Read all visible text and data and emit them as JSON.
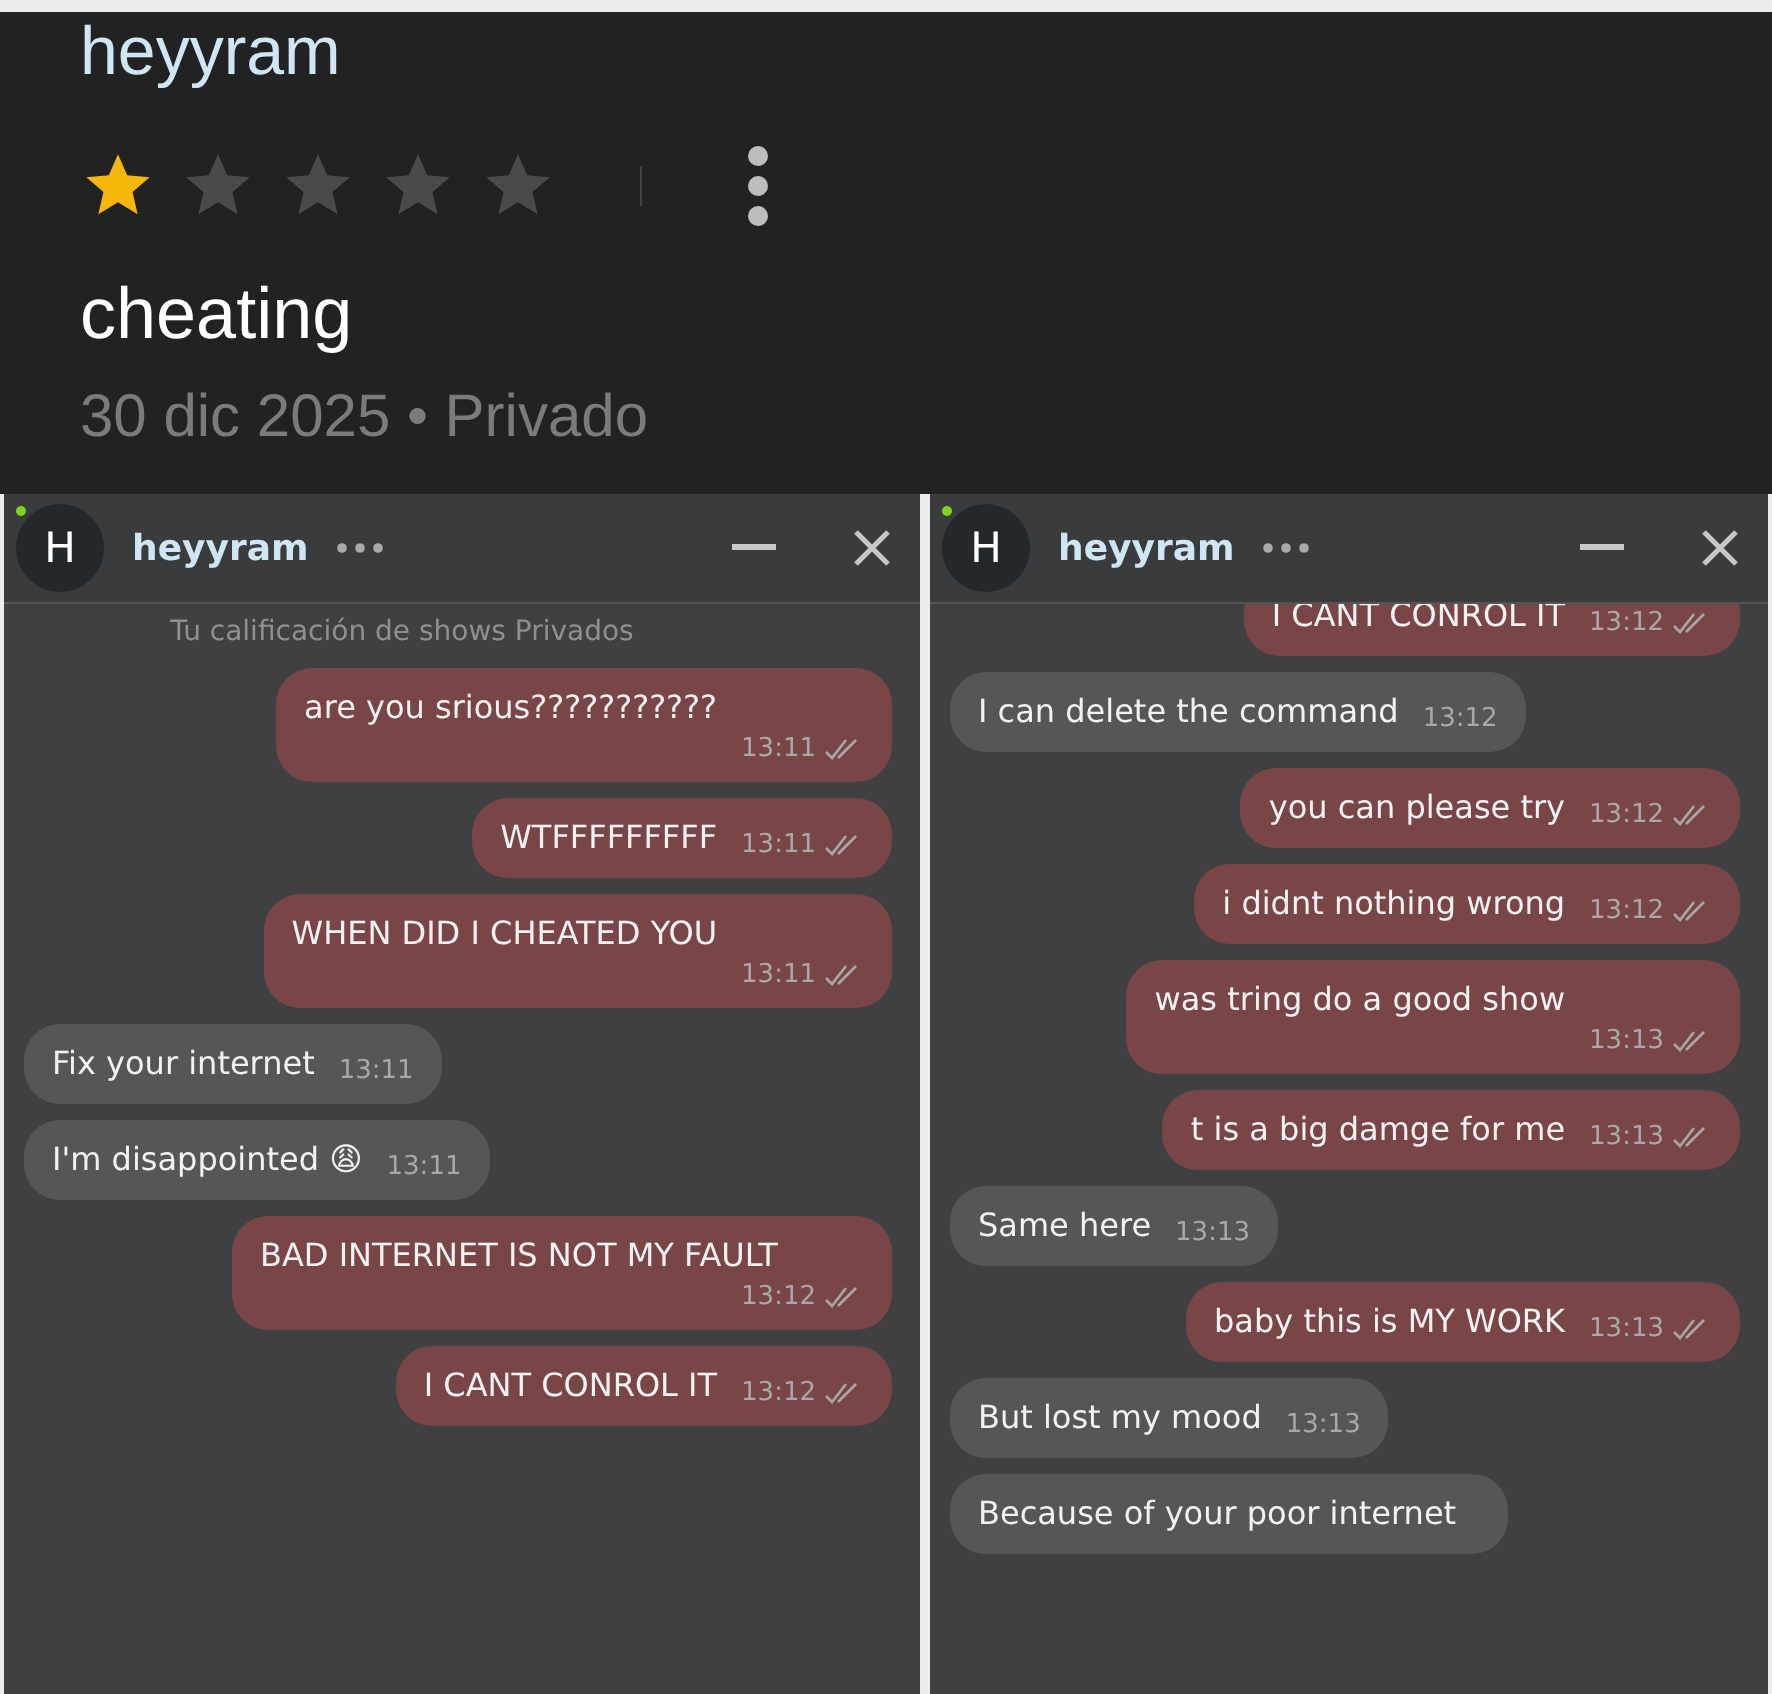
{
  "review": {
    "author": "heyyram",
    "stars": 1,
    "comment": "cheating",
    "date_line": "30 dic 2025 • Privado"
  },
  "chats": [
    {
      "name": "heyyram",
      "avatar": "H",
      "online": true,
      "notice": "Tu calificación de shows Privados",
      "clipped_top": false,
      "messages": [
        {
          "kind": "sent",
          "text": "are you srious???????????",
          "time": "13:11",
          "read": true,
          "break": true
        },
        {
          "kind": "sent",
          "text": "WTFFFFFFFFF",
          "time": "13:11",
          "read": true,
          "break": false
        },
        {
          "kind": "sent",
          "text": "WHEN DID I CHEATED YOU",
          "time": "13:11",
          "read": true,
          "break": true
        },
        {
          "kind": "received",
          "text": "Fix your internet",
          "time": "13:11",
          "read": false,
          "break": false
        },
        {
          "kind": "received",
          "text": "I'm disappointed 😩",
          "time": "13:11",
          "read": false,
          "break": false
        },
        {
          "kind": "sent",
          "text": "BAD INTERNET IS NOT MY FAULT",
          "time": "13:12",
          "read": true,
          "break": true
        },
        {
          "kind": "sent",
          "text": "I CANT CONROL IT",
          "time": "13:12",
          "read": true,
          "break": false
        }
      ]
    },
    {
      "name": "heyyram",
      "avatar": "H",
      "online": true,
      "clipped_top": true,
      "messages": [
        {
          "kind": "sent",
          "text": "I CANT CONROL IT",
          "time": "13:12",
          "read": true,
          "break": false
        },
        {
          "kind": "received",
          "text": "I can delete the command",
          "time": "13:12",
          "read": false,
          "break": false
        },
        {
          "kind": "sent",
          "text": "you can please try",
          "time": "13:12",
          "read": true,
          "break": false
        },
        {
          "kind": "sent",
          "text": "i didnt nothing wrong",
          "time": "13:12",
          "read": true,
          "break": false
        },
        {
          "kind": "sent",
          "text": "was tring do a good show",
          "time": "13:13",
          "read": true,
          "break": true
        },
        {
          "kind": "sent",
          "text": "t is a big damge for me",
          "time": "13:13",
          "read": true,
          "break": false
        },
        {
          "kind": "received",
          "text": "Same here",
          "time": "13:13",
          "read": false,
          "break": false
        },
        {
          "kind": "sent",
          "text": "baby this is MY WORK",
          "time": "13:13",
          "read": true,
          "break": false
        },
        {
          "kind": "received",
          "text": "But lost my mood",
          "time": "13:13",
          "read": false,
          "break": false
        },
        {
          "kind": "received",
          "text": "Because of your poor internet",
          "read": false,
          "break": false
        }
      ]
    }
  ]
}
